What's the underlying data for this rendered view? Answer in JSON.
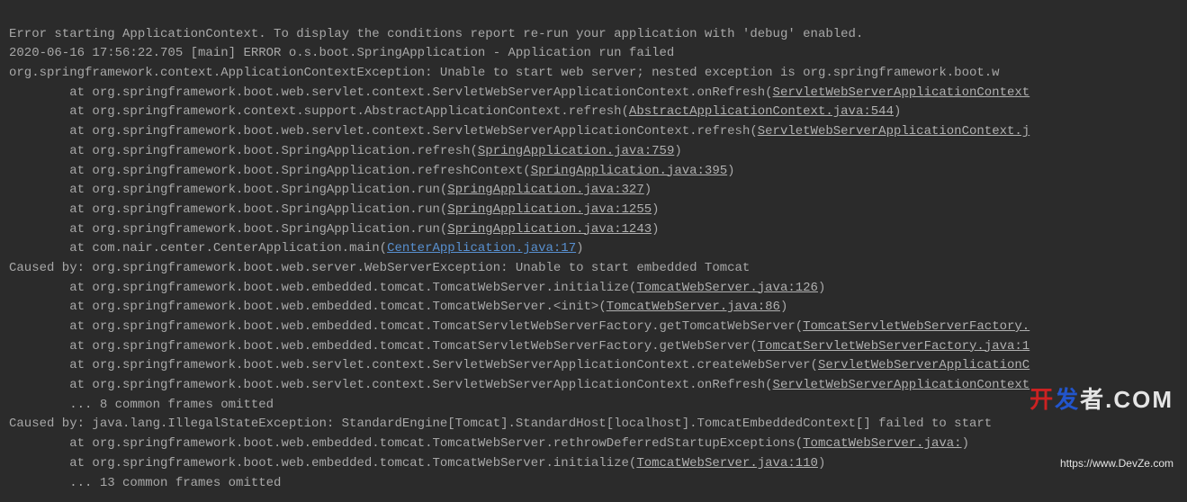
{
  "log": {
    "line1": "Error starting ApplicationContext. To display the conditions report re-run your application with 'debug' enabled.",
    "line2": "2020-06-16 17:56:22.705 [main] ERROR o.s.boot.SpringApplication - Application run failed",
    "line3": "org.springframework.context.ApplicationContextException: Unable to start web server; nested exception is org.springframework.boot.w",
    "frames1": {
      "f0": {
        "pre": "\tat org.springframework.boot.web.servlet.context.ServletWebServerApplicationContext.onRefresh(",
        "link": "ServletWebServerApplicationContext",
        "post": ""
      },
      "f1": {
        "pre": "\tat org.springframework.context.support.AbstractApplicationContext.refresh(",
        "link": "AbstractApplicationContext.java:544",
        "post": ")"
      },
      "f2": {
        "pre": "\tat org.springframework.boot.web.servlet.context.ServletWebServerApplicationContext.refresh(",
        "link": "ServletWebServerApplicationContext.j",
        "post": ""
      },
      "f3": {
        "pre": "\tat org.springframework.boot.SpringApplication.refresh(",
        "link": "SpringApplication.java:759",
        "post": ")"
      },
      "f4": {
        "pre": "\tat org.springframework.boot.SpringApplication.refreshContext(",
        "link": "SpringApplication.java:395",
        "post": ")"
      },
      "f5": {
        "pre": "\tat org.springframework.boot.SpringApplication.run(",
        "link": "SpringApplication.java:327",
        "post": ")"
      },
      "f6": {
        "pre": "\tat org.springframework.boot.SpringApplication.run(",
        "link": "SpringApplication.java:1255",
        "post": ")"
      },
      "f7": {
        "pre": "\tat org.springframework.boot.SpringApplication.run(",
        "link": "SpringApplication.java:1243",
        "post": ")"
      },
      "f8": {
        "pre": "\tat com.nair.center.CenterApplication.main(",
        "link": "CenterApplication.java:17",
        "post": ")"
      }
    },
    "caused1": "Caused by: org.springframework.boot.web.server.WebServerException: Unable to start embedded Tomcat",
    "frames2": {
      "f0": {
        "pre": "\tat org.springframework.boot.web.embedded.tomcat.TomcatWebServer.initialize(",
        "link": "TomcatWebServer.java:126",
        "post": ")"
      },
      "f1": {
        "pre": "\tat org.springframework.boot.web.embedded.tomcat.TomcatWebServer.<init>(",
        "link": "TomcatWebServer.java:86",
        "post": ")"
      },
      "f2": {
        "pre": "\tat org.springframework.boot.web.embedded.tomcat.TomcatServletWebServerFactory.getTomcatWebServer(",
        "link": "TomcatServletWebServerFactory.",
        "post": ""
      },
      "f3": {
        "pre": "\tat org.springframework.boot.web.embedded.tomcat.TomcatServletWebServerFactory.getWebServer(",
        "link": "TomcatServletWebServerFactory.java:1",
        "post": ""
      },
      "f4": {
        "pre": "\tat org.springframework.boot.web.servlet.context.ServletWebServerApplicationContext.createWebServer(",
        "link": "ServletWebServerApplicationC",
        "post": ""
      },
      "f5": {
        "pre": "\tat org.springframework.boot.web.servlet.context.ServletWebServerApplicationContext.onRefresh(",
        "link": "ServletWebServerApplicationContext",
        "post": ""
      }
    },
    "omitted1": "\t... 8 common frames omitted",
    "caused2": "Caused by: java.lang.IllegalStateException: StandardEngine[Tomcat].StandardHost[localhost].TomcatEmbeddedContext[] failed to start",
    "frames3": {
      "f0": {
        "pre": "\tat org.springframework.boot.web.embedded.tomcat.TomcatWebServer.rethrowDeferredStartupExceptions(",
        "link": "TomcatWebServer.java:",
        "post": ")"
      },
      "f1": {
        "pre": "\tat org.springframework.boot.web.embedded.tomcat.TomcatWebServer.initialize(",
        "link": "TomcatWebServer.java:110",
        "post": ")"
      }
    },
    "omitted2": "\t... 13 common frames omitted"
  },
  "watermark": {
    "brand_prefix": "开",
    "brand_mid": "发",
    "brand_suffix": "者.COM",
    "url": "https://www.DevZe.com"
  }
}
